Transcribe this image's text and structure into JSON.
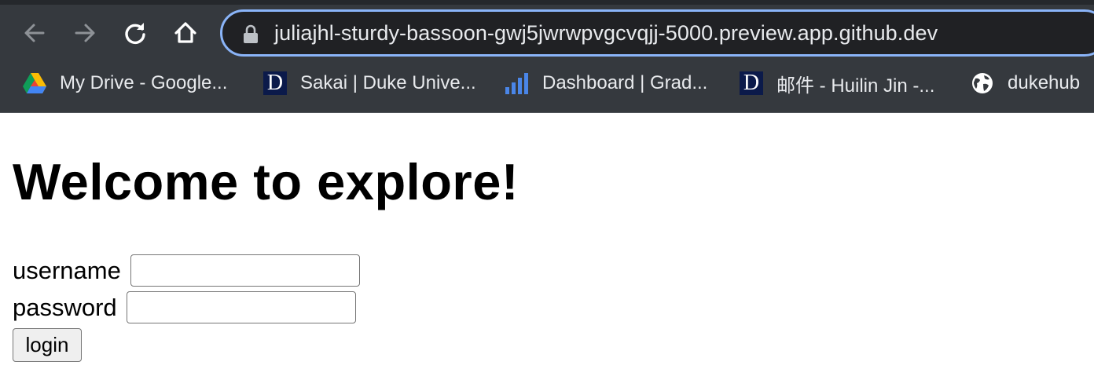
{
  "browser": {
    "url": "juliajhl-sturdy-bassoon-gwj5jwrwpvgcvqjj-5000.preview.app.github.dev",
    "nav_icons": [
      "back-arrow-icon",
      "forward-arrow-icon",
      "reload-icon",
      "home-icon",
      "lock-icon"
    ],
    "bookmarks": [
      {
        "label": "My Drive - Google...",
        "icon": "google-drive-icon"
      },
      {
        "label": "Sakai | Duke Unive...",
        "icon": "duke-d-icon",
        "icon_text": "D"
      },
      {
        "label": "Dashboard | Grad...",
        "icon": "bar-chart-icon"
      },
      {
        "label": "邮件 - Huilin Jin -...",
        "icon": "duke-d-icon",
        "icon_text": "D"
      },
      {
        "label": "dukehub",
        "icon": "globe-icon"
      }
    ]
  },
  "page": {
    "title": "Welcome to explore!",
    "username_label": "username",
    "username_value": "",
    "password_label": "password",
    "password_value": "",
    "login_label": "login"
  },
  "colors": {
    "chrome_bg": "#35393e",
    "address_bar_bg": "#202124",
    "address_focus_ring": "#8ab4f8",
    "duke_blue": "#0b1a4a"
  }
}
